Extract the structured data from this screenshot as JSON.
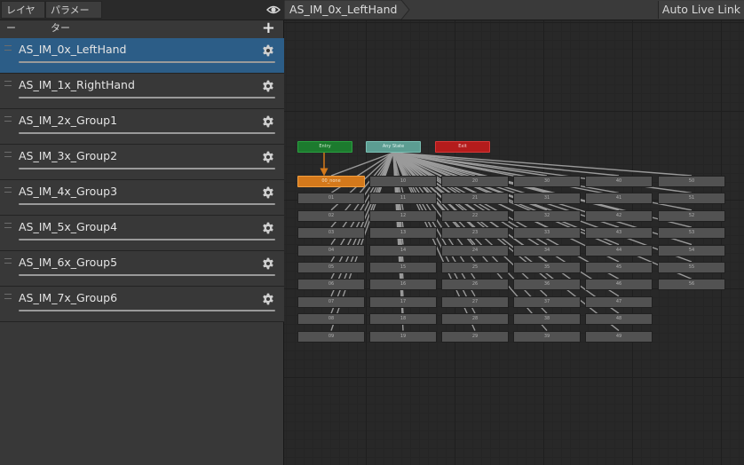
{
  "tabs": {
    "layers": "レイヤー",
    "parameters": "パラメーター"
  },
  "layers": [
    {
      "name": "AS_IM_0x_LeftHand",
      "selected": true
    },
    {
      "name": "AS_IM_1x_RightHand"
    },
    {
      "name": "AS_IM_2x_Group1"
    },
    {
      "name": "AS_IM_3x_Group2"
    },
    {
      "name": "AS_IM_4x_Group3"
    },
    {
      "name": "AS_IM_5x_Group4"
    },
    {
      "name": "AS_IM_6x_Group5"
    },
    {
      "name": "AS_IM_7x_Group6"
    }
  ],
  "breadcrumb": "AS_IM_0x_LeftHand",
  "live_link": "Auto Live Link",
  "graph": {
    "entry": "Entry",
    "any_state": "Any State",
    "exit": "Exit",
    "columns": [
      [
        "00_none",
        "01",
        "02",
        "03",
        "04",
        "05",
        "06",
        "07",
        "08",
        "09"
      ],
      [
        "10",
        "11",
        "12",
        "13",
        "14",
        "15",
        "16",
        "17",
        "18",
        "19"
      ],
      [
        "20",
        "21",
        "22",
        "23",
        "24",
        "25",
        "26",
        "27",
        "28",
        "29"
      ],
      [
        "30",
        "31",
        "32",
        "33",
        "34",
        "35",
        "36",
        "37",
        "38",
        "39"
      ],
      [
        "40",
        "41",
        "42",
        "43",
        "44",
        "45",
        "46",
        "47",
        "48",
        "49"
      ],
      [
        "50",
        "51",
        "52",
        "53",
        "54",
        "55",
        "56"
      ]
    ]
  },
  "colors": {
    "selected_layer": "#2c5d87",
    "default_state": "#d4791b",
    "entry_state": "#1c7a2e",
    "any_state": "#5c9d92",
    "exit_state": "#b41c1c",
    "state": "#525252"
  }
}
